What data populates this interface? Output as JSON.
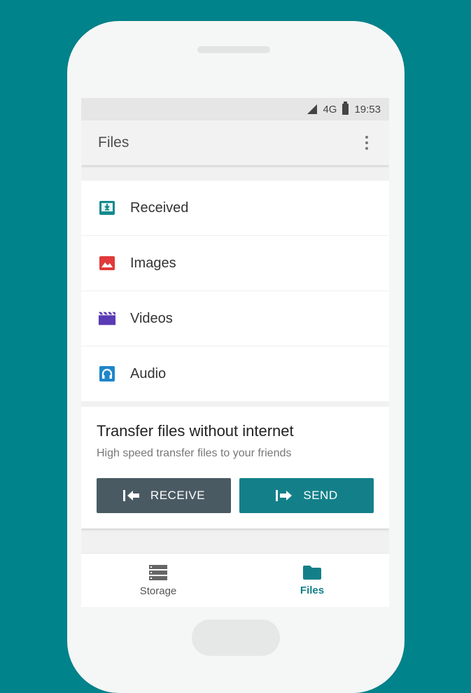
{
  "status_bar": {
    "network": "4G",
    "time": "19:53"
  },
  "app_bar": {
    "title": "Files"
  },
  "categories": [
    {
      "label": "Received",
      "icon": "download-tray-icon",
      "color": "#148a8f"
    },
    {
      "label": "Images",
      "icon": "image-icon",
      "color": "#e03a3a"
    },
    {
      "label": "Videos",
      "icon": "clapperboard-icon",
      "color": "#5b3bb5"
    },
    {
      "label": "Audio",
      "icon": "headphones-icon",
      "color": "#1f86c9"
    }
  ],
  "transfer": {
    "title": "Transfer files without internet",
    "subtitle": "High speed transfer files to your friends",
    "receive_label": "RECEIVE",
    "send_label": "SEND"
  },
  "bottom_nav": {
    "items": [
      {
        "label": "Storage",
        "icon": "storage-icon",
        "active": false
      },
      {
        "label": "Files",
        "icon": "folder-icon",
        "active": true
      }
    ]
  },
  "colors": {
    "background": "#00838b",
    "accent": "#138089",
    "receive_button": "#4a5a63"
  }
}
